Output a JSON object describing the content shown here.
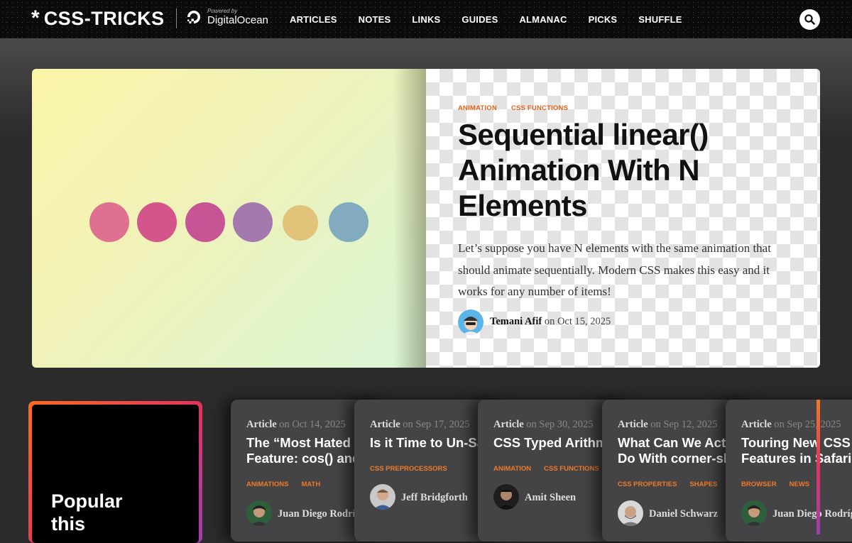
{
  "header": {
    "logo_star": "*",
    "logo_text": "CSS-TRICKS",
    "sponsor_small": "Powered by",
    "sponsor_name": "DigitalOcean",
    "nav": [
      "ARTICLES",
      "NOTES",
      "LINKS",
      "GUIDES",
      "ALMANAC",
      "PICKS",
      "SHUFFLE"
    ]
  },
  "hero": {
    "tags": [
      "ANIMATION",
      "CSS FUNCTIONS"
    ],
    "title": "Sequential linear() Animation With N Elements",
    "excerpt": "Let’s suppose you have N elements with the same animation that should animate sequentially. Modern CSS makes this easy and it works for any number of items!",
    "author": "Temani Afif",
    "date_text": "on Oct 15, 2025",
    "dot_colors": [
      "#e07090",
      "#d4558a",
      "#c75596",
      "#a47aae",
      "#e1c47a",
      "#82abc0"
    ]
  },
  "popular": {
    "title_line1": "Popular",
    "title_line2": "this"
  },
  "cards": [
    {
      "type": "Article",
      "date": "on Oct 14, 2025",
      "title1": "The “Most Hated",
      "title2": "Feature: cos() and",
      "tags": [
        "ANIMATIONS",
        "MATH"
      ],
      "author": "Juan Diego Rodríguez"
    },
    {
      "type": "Article",
      "date": "on Sep 17, 2025",
      "title1": "Is it Time to Un-Sass?",
      "title2": "",
      "tags": [
        "CSS PREPROCESSORS"
      ],
      "author": "Jeff Bridgforth"
    },
    {
      "type": "Article",
      "date": "on Sep 30, 2025",
      "title1": "CSS Typed Arithmetic",
      "title2": "",
      "tags": [
        "ANIMATION",
        "CSS FUNCTIONS"
      ],
      "author": "Amit Sheen"
    },
    {
      "type": "Article",
      "date": "on Sep 12, 2025",
      "title1": "What Can We Actually",
      "title2": "Do With corner-shape?",
      "tags": [
        "CSS PROPERTIES",
        "SHAPES"
      ],
      "author": "Daniel Schwarz"
    },
    {
      "type": "Article",
      "date": "on Sep 25, 2025",
      "title1": "Touring New CSS",
      "title2": "Features in Safari",
      "tags": [
        "BROWSER",
        "NEWS"
      ],
      "author": "Juan Diego Rodríguez"
    }
  ]
}
